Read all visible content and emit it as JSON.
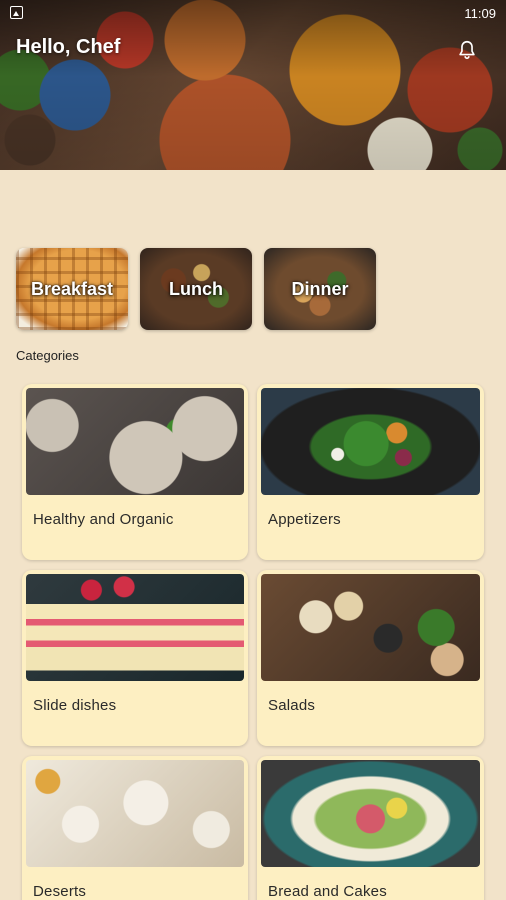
{
  "status_bar": {
    "time": "11:09"
  },
  "header": {
    "greeting": "Hello, Chef"
  },
  "meals": [
    {
      "label": "Breakfast"
    },
    {
      "label": "Lunch"
    },
    {
      "label": "Dinner"
    }
  ],
  "categories": {
    "title": "Categories",
    "items": [
      {
        "name": "Healthy and Organic"
      },
      {
        "name": "Appetizers"
      },
      {
        "name": "Slide dishes"
      },
      {
        "name": "Salads"
      },
      {
        "name": "Deserts"
      },
      {
        "name": "Bread and Cakes"
      }
    ]
  },
  "colors": {
    "background": "#f2e3c9",
    "card": "#fdefc2"
  },
  "icons": [
    "image-icon",
    "bell-icon"
  ]
}
